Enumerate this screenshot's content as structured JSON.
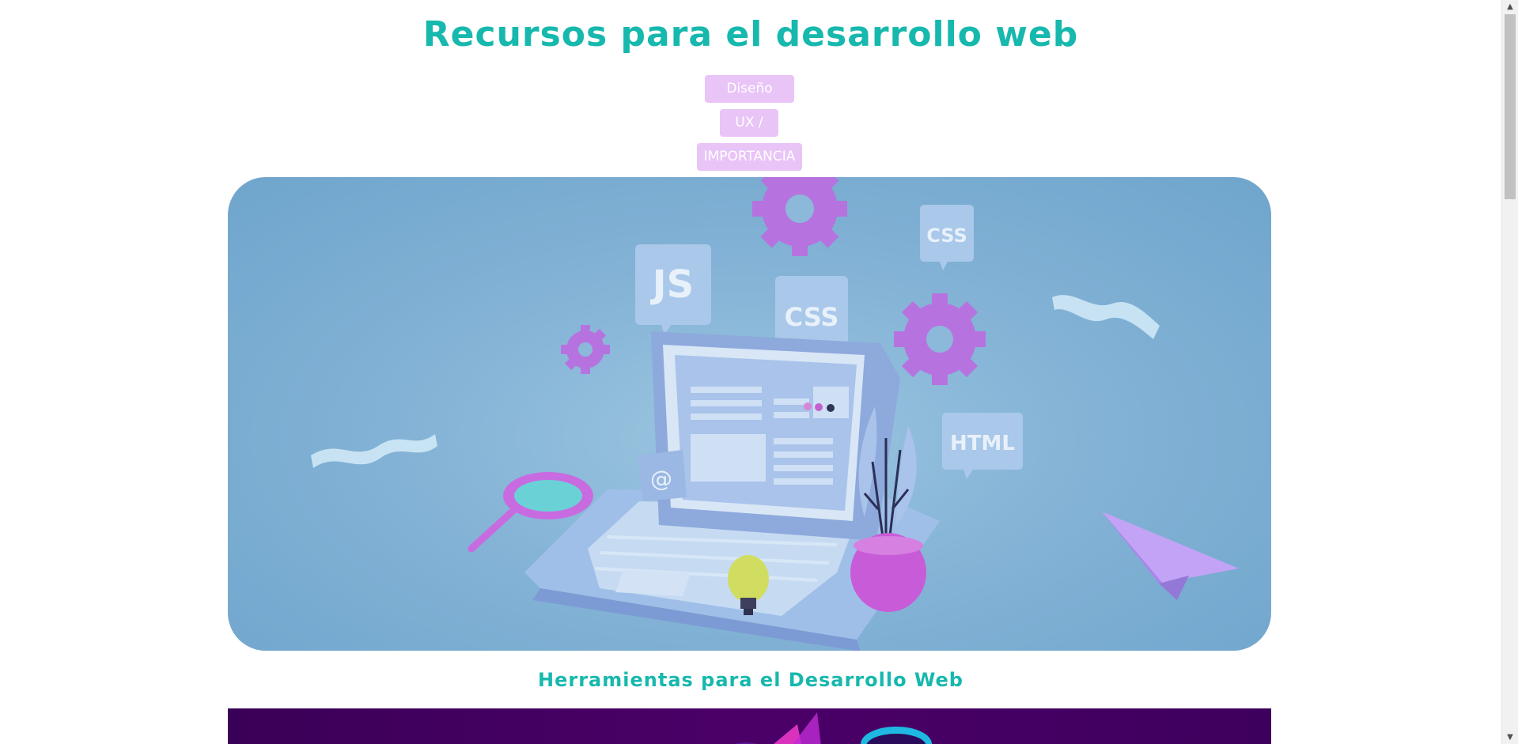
{
  "header": {
    "title": "Recursos para el desarrollo web"
  },
  "nav": {
    "items": [
      {
        "label": "Diseño Web"
      },
      {
        "label": "UX / UI"
      },
      {
        "label": "IMPORTANCIA"
      }
    ]
  },
  "hero": {
    "labels": {
      "js": "JS",
      "css1": "CSS",
      "css2": "CSS",
      "html": "HTML",
      "at": "@"
    }
  },
  "section": {
    "title": "Herramientas para el Desarrollo Web"
  },
  "colors": {
    "accent": "#17b8ad",
    "nav_button_bg": "#e9c4f7",
    "hero_bg": "#7fb0d4",
    "gear": "#b673e0",
    "second_image_bg": "#45005f"
  },
  "icons": {
    "scroll_up": "▲",
    "scroll_down": "▼"
  }
}
